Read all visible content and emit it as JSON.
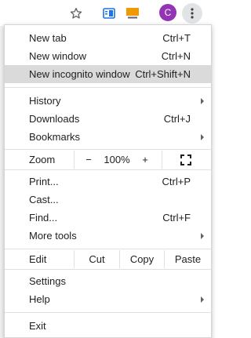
{
  "toolbar": {
    "avatar_letter": "C",
    "icons": [
      "star-icon",
      "extension-icon",
      "extension-icon",
      "more-vert-icon"
    ],
    "colors": {
      "avatar": "#9334b4",
      "extension_blue": "#1a73e8",
      "extension_orange": "#f29900"
    }
  },
  "menu": {
    "new_tab": {
      "label": "New tab",
      "shortcut": "Ctrl+T"
    },
    "new_window": {
      "label": "New window",
      "shortcut": "Ctrl+N"
    },
    "new_incognito": {
      "label": "New incognito window",
      "shortcut": "Ctrl+Shift+N"
    },
    "history": {
      "label": "History"
    },
    "downloads": {
      "label": "Downloads",
      "shortcut": "Ctrl+J"
    },
    "bookmarks": {
      "label": "Bookmarks"
    },
    "zoom": {
      "label": "Zoom",
      "minus": "−",
      "level": "100%",
      "plus": "+"
    },
    "print": {
      "label": "Print...",
      "shortcut": "Ctrl+P"
    },
    "cast": {
      "label": "Cast..."
    },
    "find": {
      "label": "Find...",
      "shortcut": "Ctrl+F"
    },
    "more_tools": {
      "label": "More tools"
    },
    "edit": {
      "label": "Edit",
      "cut": "Cut",
      "copy": "Copy",
      "paste": "Paste"
    },
    "settings": {
      "label": "Settings"
    },
    "help": {
      "label": "Help"
    },
    "exit": {
      "label": "Exit"
    }
  }
}
